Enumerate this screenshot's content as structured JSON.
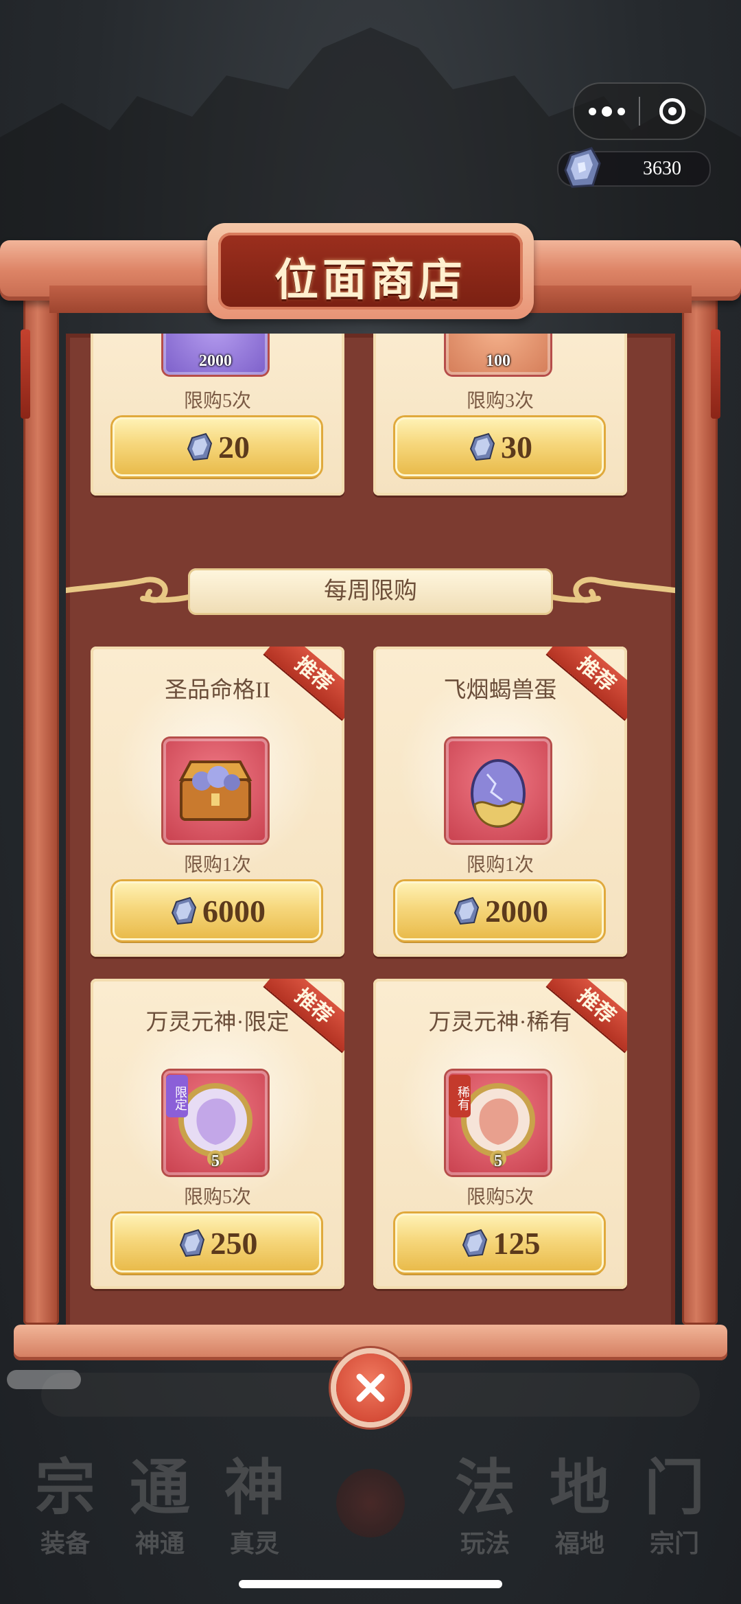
{
  "currency": {
    "value": "3630",
    "icon": "spirit-stone-icon"
  },
  "capsule": {
    "more_icon": "more-dots-icon",
    "close_icon": "target-icon"
  },
  "shop": {
    "title": "位面商店"
  },
  "top_items": [
    {
      "qty": "2000",
      "limit": "限购5次",
      "price": "20",
      "frame": "purple"
    },
    {
      "qty": "100",
      "limit": "限购3次",
      "price": "30",
      "frame": "orange"
    }
  ],
  "weekly": {
    "header": "每周限购",
    "items": [
      {
        "name": "圣品命格II",
        "limit": "限购1次",
        "price": "6000",
        "badge": "推荐",
        "icon": "treasure-chest-icon"
      },
      {
        "name": "飞烟蝎兽蛋",
        "limit": "限购1次",
        "price": "2000",
        "badge": "推荐",
        "icon": "beast-egg-icon"
      },
      {
        "name": "万灵元神·限定",
        "limit": "限购5次",
        "price": "250",
        "badge": "推荐",
        "icon": "spirit-portrait-icon",
        "tag": "限定",
        "level": "5"
      },
      {
        "name": "万灵元神·稀有",
        "limit": "限购5次",
        "price": "125",
        "badge": "推荐",
        "icon": "spirit-portrait-icon",
        "tag": "稀有",
        "level": "5"
      }
    ]
  },
  "nav": {
    "items": [
      {
        "glyph": "宗",
        "label": "装备"
      },
      {
        "glyph": "通",
        "label": "神通"
      },
      {
        "glyph": "神",
        "label": "真灵"
      },
      {
        "glyph": "法",
        "label": "玩法"
      },
      {
        "glyph": "地",
        "label": "福地"
      },
      {
        "glyph": "门",
        "label": "宗门"
      }
    ]
  },
  "colors": {
    "accent": "#cc3d2a",
    "gold": "#f6d77c",
    "panel": "#7c3b30",
    "card": "#fbecd0"
  }
}
